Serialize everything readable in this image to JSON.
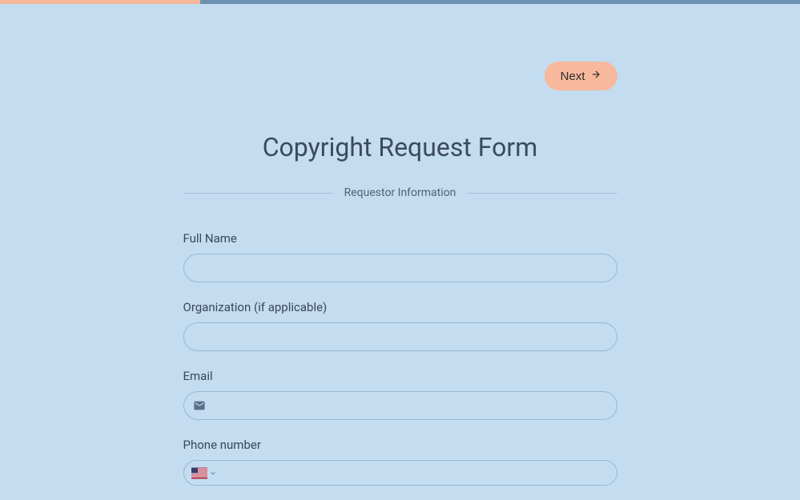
{
  "progress": {
    "percent": 25
  },
  "navigation": {
    "next_label": "Next"
  },
  "form": {
    "title": "Copyright Request Form",
    "section_label": "Requestor Information",
    "fields": {
      "full_name": {
        "label": "Full Name",
        "value": ""
      },
      "organization": {
        "label": "Organization (if applicable)",
        "value": ""
      },
      "email": {
        "label": "Email",
        "value": ""
      },
      "phone": {
        "label": "Phone number",
        "value": "",
        "country": "US"
      }
    }
  }
}
